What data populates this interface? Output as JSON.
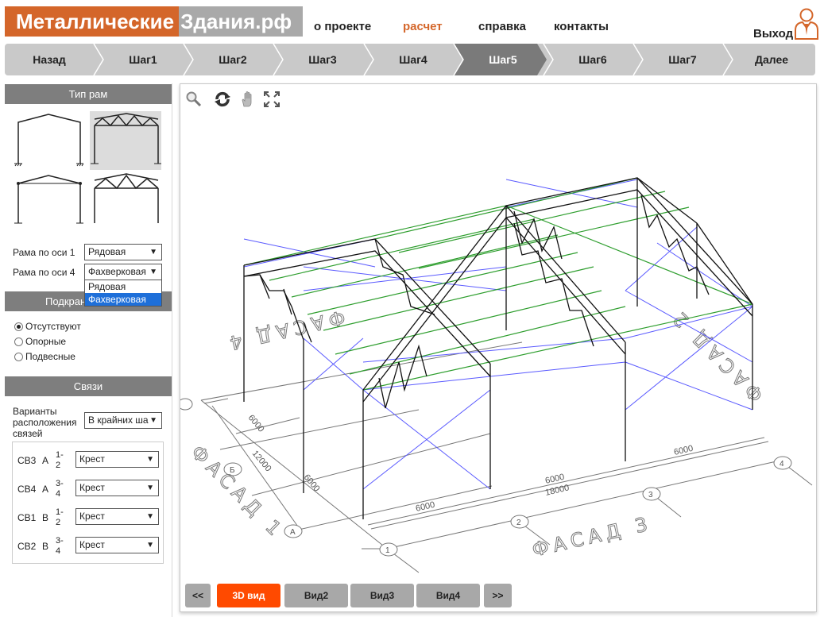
{
  "header": {
    "logo_part1": "Металлические",
    "logo_part2": "Здания.рф",
    "nav": [
      {
        "label": "о проекте"
      },
      {
        "label": "расчет"
      },
      {
        "label": "справка"
      },
      {
        "label": "контакты"
      }
    ],
    "exit_label": "Выход",
    "accent_color": "#d4662a"
  },
  "steps": {
    "items": [
      {
        "label": "Назад"
      },
      {
        "label": "Шаг1"
      },
      {
        "label": "Шаг2"
      },
      {
        "label": "Шаг3"
      },
      {
        "label": "Шаг4"
      },
      {
        "label": "Шаг5"
      },
      {
        "label": "Шаг6"
      },
      {
        "label": "Шаг7"
      },
      {
        "label": "Далее"
      }
    ],
    "active": "Шаг5"
  },
  "frame_type": {
    "title": "Тип рам",
    "options": [
      "rigid-frame",
      "truss-frame-selected",
      "hinged-frame",
      "truss-frame-2"
    ],
    "axis1_label": "Рама по оси 1",
    "axis1_value": "Рядовая",
    "axis4_label": "Рама по оси 4",
    "axis4_value": "Фахверковая",
    "dropdown_options": [
      "Рядовая",
      "Фахверковая"
    ],
    "dropdown_highlighted": "Фахверковая"
  },
  "crane": {
    "title": "Подкрановые балки",
    "title_visible": "Подкран",
    "options": [
      "Отсутствуют",
      "Опорные",
      "Подвесные"
    ],
    "selected": "Отсутствуют"
  },
  "connections": {
    "title": "Связи",
    "variants_label": "Варианты расположения связей",
    "variants_value": "В крайних ша",
    "rows": [
      {
        "code": "СВ3",
        "axis": "А",
        "span": "1-2",
        "value": "Крест"
      },
      {
        "code": "СВ4",
        "axis": "А",
        "span": "3-4",
        "value": "Крест"
      },
      {
        "code": "СВ1",
        "axis": "В",
        "span": "1-2",
        "value": "Крест"
      },
      {
        "code": "СВ2",
        "axis": "В",
        "span": "3-4",
        "value": "Крест"
      }
    ]
  },
  "viewer": {
    "tools": [
      "zoom-icon",
      "rotate-icon",
      "pan-hand-icon",
      "fit-extents-icon"
    ],
    "drawing_labels": {
      "facade1": "ФАСАД 1",
      "facade2": "ФАСАД 2",
      "facade3": "ФАСАД 3",
      "facade4": "ФАСАД 4",
      "dim_6000": "6000",
      "dim_12000": "12000",
      "dim_18000": "18000",
      "axis_1": "1",
      "axis_2": "2",
      "axis_3": "3",
      "axis_4": "4",
      "axis_A": "А",
      "axis_B": "Б"
    },
    "views": [
      {
        "label": "<<"
      },
      {
        "label": "3D вид"
      },
      {
        "label": "Вид2"
      },
      {
        "label": "Вид3"
      },
      {
        "label": "Вид4"
      },
      {
        "label": ">>"
      }
    ],
    "active_view": "3D вид",
    "colors": {
      "purlin": "#2e9e2e",
      "bracing": "#5a5aff",
      "frame": "#111111",
      "active_button": "#ff4a00"
    }
  }
}
